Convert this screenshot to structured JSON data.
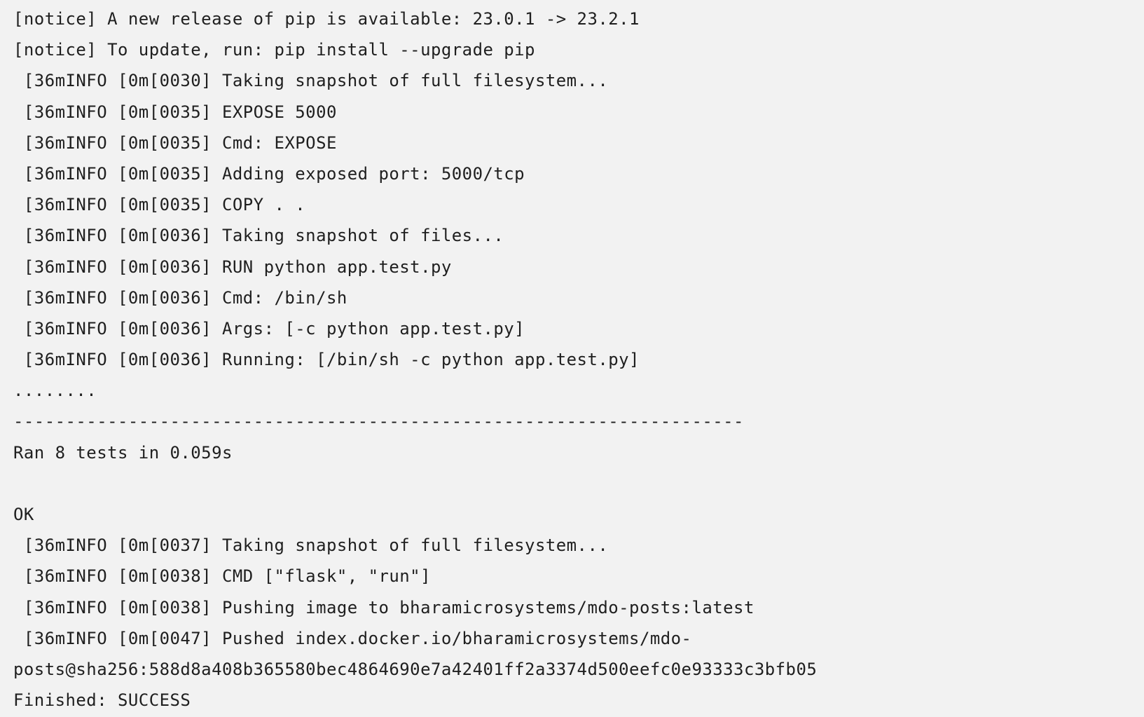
{
  "console": {
    "lines": [
      "[notice] A new release of pip is available: 23.0.1 -> 23.2.1",
      "[notice] To update, run: pip install --upgrade pip",
      " [36mINFO [0m[0030] Taking snapshot of full filesystem...",
      " [36mINFO [0m[0035] EXPOSE 5000",
      " [36mINFO [0m[0035] Cmd: EXPOSE",
      " [36mINFO [0m[0035] Adding exposed port: 5000/tcp",
      " [36mINFO [0m[0035] COPY . .",
      " [36mINFO [0m[0036] Taking snapshot of files...",
      " [36mINFO [0m[0036] RUN python app.test.py",
      " [36mINFO [0m[0036] Cmd: /bin/sh",
      " [36mINFO [0m[0036] Args: [-c python app.test.py]",
      " [36mINFO [0m[0036] Running: [/bin/sh -c python app.test.py]",
      "........",
      "----------------------------------------------------------------------",
      "Ran 8 tests in 0.059s",
      "",
      "OK",
      " [36mINFO [0m[0037] Taking snapshot of full filesystem...",
      " [36mINFO [0m[0038] CMD [\"flask\", \"run\"]",
      " [36mINFO [0m[0038] Pushing image to bharamicrosystems/mdo-posts:latest",
      " [36mINFO [0m[0047] Pushed index.docker.io/bharamicrosystems/mdo-",
      "posts@sha256:588d8a408b365580bec4864690e7a42401ff2a3374d500eefc0e93333c3bfb05",
      "Finished: SUCCESS"
    ]
  }
}
